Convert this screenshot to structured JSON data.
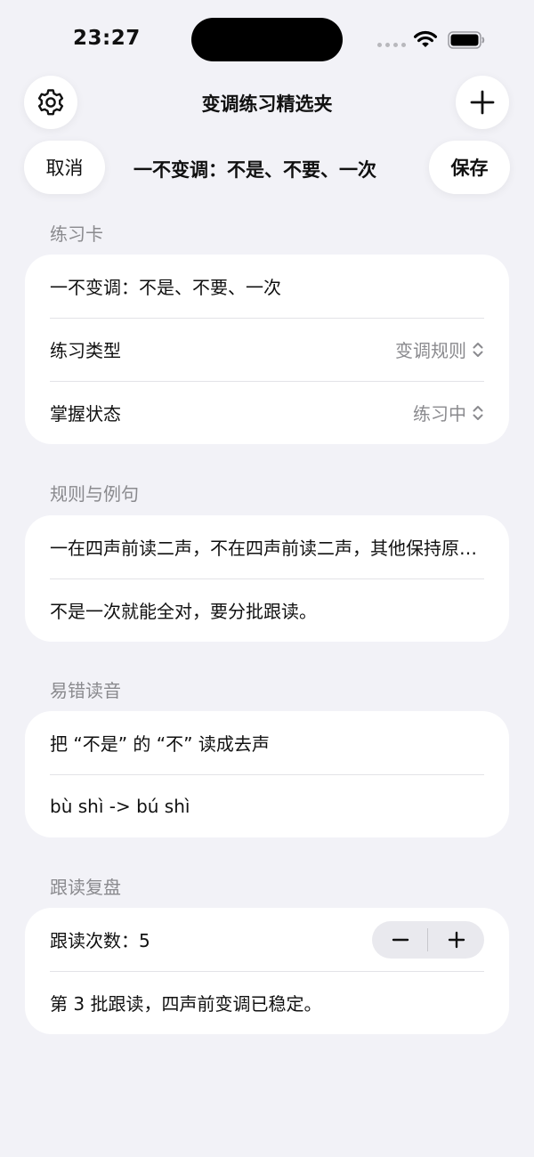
{
  "status_bar": {
    "time": "23:27"
  },
  "nav": {
    "title": "变调练习精选夹",
    "cancel_label": "取消",
    "save_label": "保存",
    "subtitle": "一不变调：不是、不要、一次"
  },
  "sections": {
    "card": {
      "header": "练习卡",
      "name": "一不变调：不是、不要、一次",
      "type_label": "练习类型",
      "type_value": "变调规则",
      "status_label": "掌握状态",
      "status_value": "练习中"
    },
    "rules": {
      "header": "规则与例句",
      "rule": "一在四声前读二声，不在四声前读二声，其他保持原调。",
      "example": "不是一次就能全对，要分批跟读。"
    },
    "errors": {
      "header": "易错读音",
      "mistake": "把 “不是” 的 “不” 读成去声",
      "correction": "bù shì -> bú shì"
    },
    "review": {
      "header": "跟读复盘",
      "count_label": "跟读次数：5",
      "note": "第 3 批跟读，四声前变调已稳定。"
    }
  },
  "icons": {
    "settings": "gear-icon",
    "add": "plus-icon",
    "popup": "chevron-up-down-icon",
    "decrement": "minus-icon",
    "increment": "plus-icon"
  }
}
